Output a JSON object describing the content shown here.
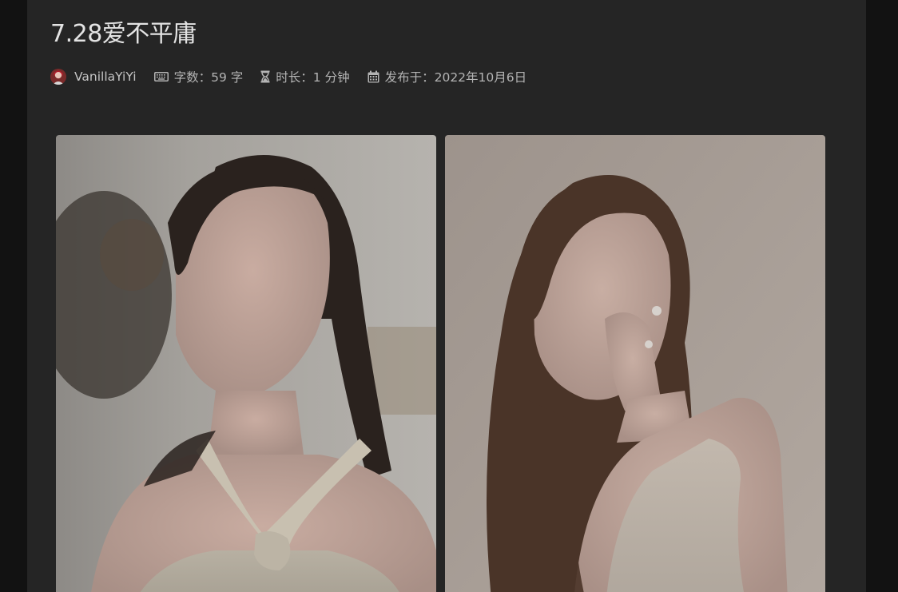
{
  "post": {
    "title": "7.28爱不平庸",
    "author": {
      "name": "VanillaYiYi",
      "avatar_icon": "avatar"
    },
    "word_count": {
      "icon": "keyboard-icon",
      "label": "字数：",
      "value": "59 字"
    },
    "reading_time": {
      "icon": "hourglass-icon",
      "label": "时长：",
      "value": "1 分钟"
    },
    "published": {
      "icon": "calendar-icon",
      "label": "发布于：",
      "value": "2022年10月6日"
    }
  },
  "gallery": {
    "photos": [
      {
        "name": "photo-left"
      },
      {
        "name": "photo-right"
      }
    ]
  },
  "colors": {
    "page_background": "#121212",
    "content_background": "#252525",
    "title_text": "#e3e3e3",
    "meta_text": "#b4b4b4"
  }
}
